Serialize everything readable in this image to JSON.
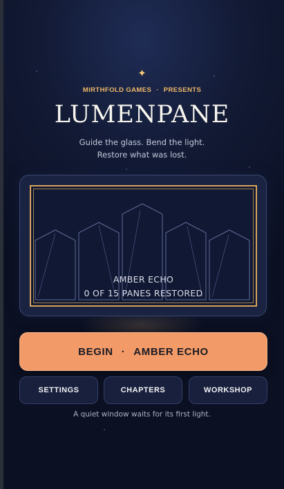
{
  "brand": {
    "star_icon": "sparkle-icon",
    "publisher": "MIRTHFOLD GAMES",
    "separator": "·",
    "presents": "PRESENTS"
  },
  "game": {
    "title": "LUMENPANE",
    "tagline_line1": "Guide the glass. Bend the light.",
    "tagline_line2": "Restore what was lost."
  },
  "level_preview": {
    "name": "AMBER ECHO",
    "progress_text": "0 OF 15 PANES RESTORED",
    "panes_restored": 0,
    "panes_total": 15
  },
  "actions": {
    "begin_label": "BEGIN",
    "begin_separator": "·",
    "begin_level": "AMBER ECHO",
    "settings_label": "SETTINGS",
    "chapters_label": "CHAPTERS",
    "workshop_label": "WORKSHOP"
  },
  "footer": {
    "message": "A quiet window waits for its first light."
  },
  "colors": {
    "accent": "#f29b68",
    "gold": "#f0b968",
    "background": "#121a35"
  }
}
